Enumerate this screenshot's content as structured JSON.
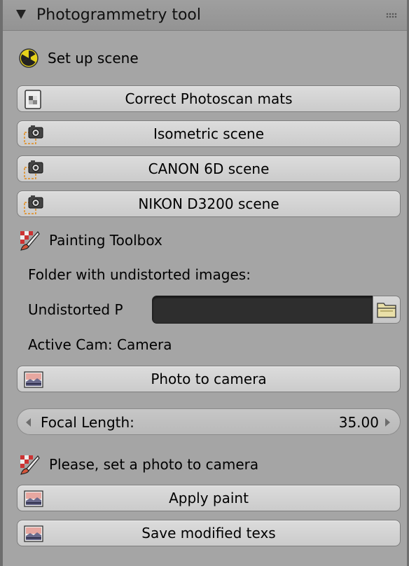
{
  "panel": {
    "title": "Photogrammetry tool"
  },
  "setup": {
    "label": "Set up scene",
    "icon": "radiation-icon"
  },
  "buttons": {
    "correct_mats": "Correct Photoscan mats",
    "isometric": "Isometric scene",
    "canon": "CANON 6D scene",
    "nikon": "NIKON D3200 scene",
    "photo_to_camera": "Photo to camera",
    "apply_paint": "Apply paint",
    "save_texs": "Save modified texs"
  },
  "painting": {
    "label": "Painting Toolbox",
    "icon": "brush-icon"
  },
  "folder": {
    "label": "Folder with undistorted images:",
    "field_label": "Undistorted P",
    "value": ""
  },
  "active_cam": "Active Cam: Camera",
  "focal": {
    "label": "Focal Length:",
    "value": "35.00"
  },
  "message": "Please, set a photo to camera",
  "colors": {
    "panel_bg": "#a5a5a5",
    "button_bg": "#d4d4d4",
    "field_bg": "#2e2e2e"
  }
}
